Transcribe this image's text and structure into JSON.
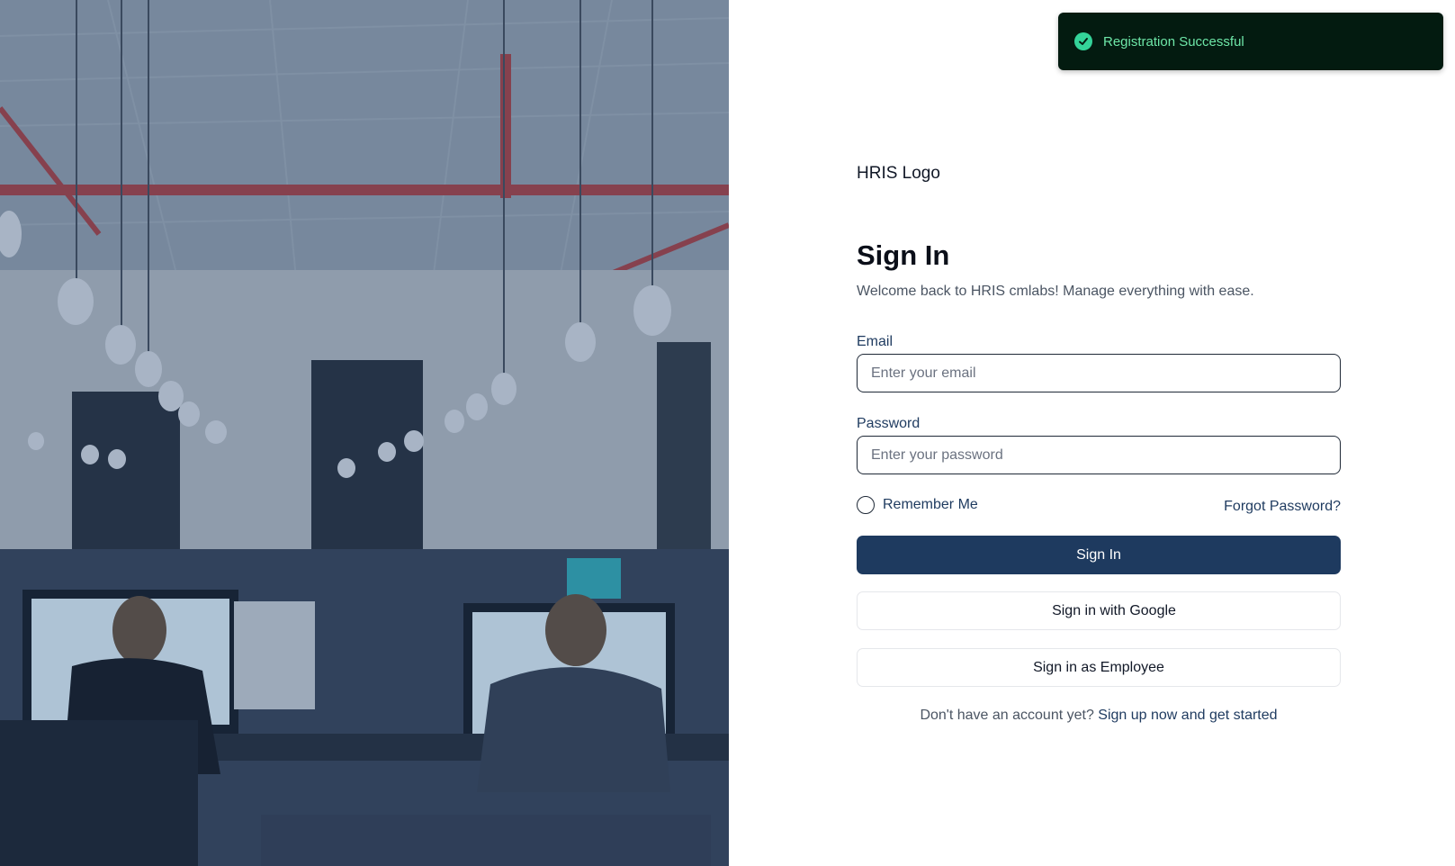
{
  "toast": {
    "message": "Registration Successful",
    "icon": "check-circle-icon",
    "color": "#34d399"
  },
  "brand": {
    "logo_text": "HRIS Logo"
  },
  "form": {
    "title": "Sign In",
    "subtitle": "Welcome back to HRIS cmlabs! Manage everything with ease.",
    "email_label": "Email",
    "email_placeholder": "Enter your email",
    "email_value": "",
    "password_label": "Password",
    "password_placeholder": "Enter your password",
    "password_value": "",
    "remember_label": "Remember Me",
    "remember_checked": false,
    "forgot_label": "Forgot Password?",
    "sign_in_label": "Sign In",
    "google_label": "Sign in with Google",
    "employee_label": "Sign in as Employee",
    "signup_prompt": "Don't have an account yet?",
    "signup_link": "Sign up now and get started"
  },
  "colors": {
    "primary": "#1e3a5f",
    "toast_bg": "#031b10",
    "toast_text": "#6ee7a8"
  }
}
